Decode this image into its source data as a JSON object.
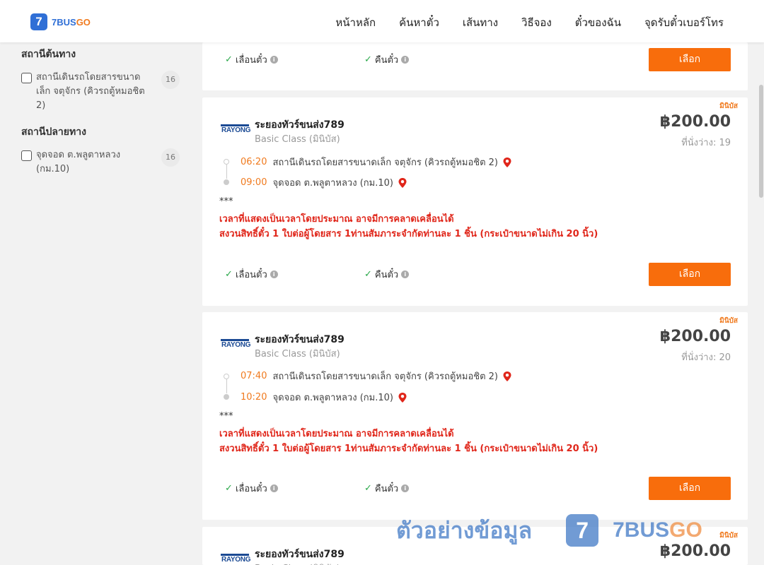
{
  "header": {
    "logo_mark": "7",
    "logo_text_1": "7BUS",
    "logo_text_2": "GO",
    "nav": [
      "หน้าหลัก",
      "ค้นหาตั๋ว",
      "เส้นทาง",
      "วิธีจอง",
      "ตั๋วของฉัน",
      "จุดรับตั๋วเบอร์โทร"
    ]
  },
  "sidebar": {
    "origin_title": "สถานีต้นทาง",
    "origin_items": [
      {
        "label": "สถานีเดินรถโดยสารขนาดเล็ก จตุจักร (คิวรถตู้หมอชิต 2)",
        "count": "16"
      }
    ],
    "dest_title": "สถานีปลายทาง",
    "dest_items": [
      {
        "label": "จุดจอด ต.พลูตาหลวง (กม.10)",
        "count": "16"
      }
    ]
  },
  "common": {
    "change_ticket": "เลื่อนตั๋ว",
    "refund_ticket": "คืนตั๋ว",
    "select_button": "เลือก",
    "bus_type": "มินิบัส",
    "operator_name": "ระยองทัวร์ขนส่ง789",
    "bus_class": "Basic Class (มินิบัส)",
    "operator_logo": "RAYONG",
    "stars": "***",
    "note_1": "เวลาที่แสดงเป็นเวลาโดยประมาณ อาจมีการคลาดเคลื่อนได้",
    "note_2": "สงวนสิทธิ์ตั๋ว 1 ใบต่อผู้โดยสาร 1ท่านสัมภาระจำกัดท่านละ 1 ชิ้น (กระเป๋าขนาดไม่เกิน 20 นิ้ว)"
  },
  "trips": [
    {
      "price": "฿200.00",
      "seats": "ที่นั่งว่าง: 19",
      "depart_time": "06:20",
      "depart_station": "สถานีเดินรถโดยสารขนาดเล็ก จตุจักร (คิวรถตู้หมอชิต 2)",
      "arrive_time": "09:00",
      "arrive_station": "จุดจอด ต.พลูตาหลวง (กม.10)"
    },
    {
      "price": "฿200.00",
      "seats": "ที่นั่งว่าง: 20",
      "depart_time": "07:40",
      "depart_station": "สถานีเดินรถโดยสารขนาดเล็ก จตุจักร (คิวรถตู้หมอชิต 2)",
      "arrive_time": "10:20",
      "arrive_station": "จุดจอด ต.พลูตาหลวง (กม.10)"
    },
    {
      "price": "฿200.00"
    }
  ],
  "watermark": {
    "text": "ตัวอย่างข้อมูล",
    "logo_mark": "7",
    "brand_1": "7BUS",
    "brand_2": "GO"
  }
}
